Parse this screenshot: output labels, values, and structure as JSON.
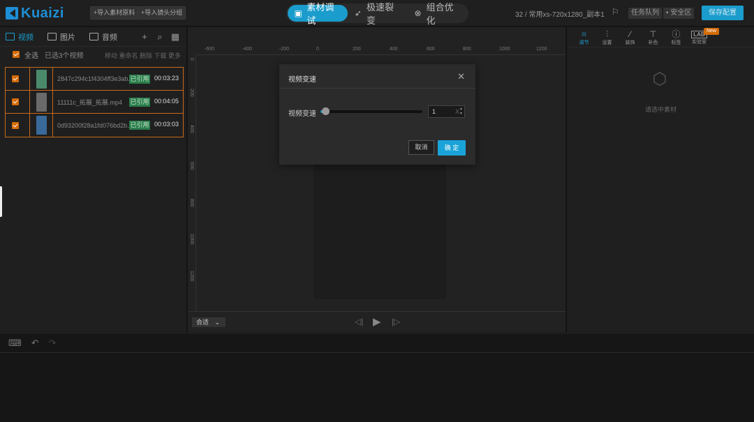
{
  "app": {
    "logo_text": "Kuaizi",
    "brand_color": "#1d8fd6",
    "accent_color": "#1a9ccc"
  },
  "topbar": {
    "import_material": "+导入素材原料",
    "import_shot_group": "+导入镜头分组",
    "modes": [
      {
        "label": "素材调试",
        "icon": "film-icon",
        "active": true
      },
      {
        "label": "极速裂变",
        "icon": "rocket-icon",
        "active": false
      },
      {
        "label": "组合优化",
        "icon": "combine-icon",
        "active": false
      }
    ],
    "project_info": "32 / 常用xs-720x1280_副本1",
    "task_queue": "任务队列",
    "safe_zone": "安全区",
    "save_config": "保存配置"
  },
  "left": {
    "tabs": [
      {
        "label": "视频",
        "active": true
      },
      {
        "label": "图片",
        "active": false
      },
      {
        "label": "音频",
        "active": false
      }
    ],
    "select_all": "全选",
    "selected_count": "已选3个视频",
    "actions": "移动 重命名 删除 下载 更多",
    "files": [
      {
        "name": "2847c294c1f4304ff3e3ab...",
        "badge": "已引用",
        "duration": "00:03:23",
        "thumb_color": "#4a8a6a"
      },
      {
        "name": "11111c_拓展_拓展.mp4",
        "badge": "已引用",
        "duration": "00:04:05",
        "thumb_color": "#6a6a6a"
      },
      {
        "name": "0d93200f28a1fd076bd2b...",
        "badge": "已引用",
        "duration": "00:03:03",
        "thumb_color": "#3a6a9a"
      }
    ]
  },
  "center": {
    "ruler_top": [
      "-600",
      "-400",
      "-200",
      "0",
      "200",
      "400",
      "600",
      "800",
      "1000",
      "1200"
    ],
    "ruler_left": [
      "0",
      "200",
      "400",
      "600",
      "800",
      "1000",
      "1200"
    ],
    "fit_label": "合适"
  },
  "right": {
    "tabs": [
      {
        "label": "调节",
        "icon": "crop-icon",
        "active": true
      },
      {
        "label": "设置",
        "icon": "sliders-icon",
        "active": false
      },
      {
        "label": "装饰",
        "icon": "wand-icon",
        "active": false
      },
      {
        "label": "补色",
        "icon": "brush-icon",
        "active": false
      },
      {
        "label": "标签",
        "icon": "info-icon",
        "active": false
      },
      {
        "label": "实验室",
        "icon": "lab-icon",
        "active": false
      }
    ],
    "new_badge": "New",
    "empty_text": "请选中素材"
  },
  "modal": {
    "title": "视频变速",
    "speed_label": "视频变速",
    "speed_value": "1",
    "speed_unit": "X",
    "speed_level": 0.05,
    "cancel": "取消",
    "confirm": "确 定"
  }
}
